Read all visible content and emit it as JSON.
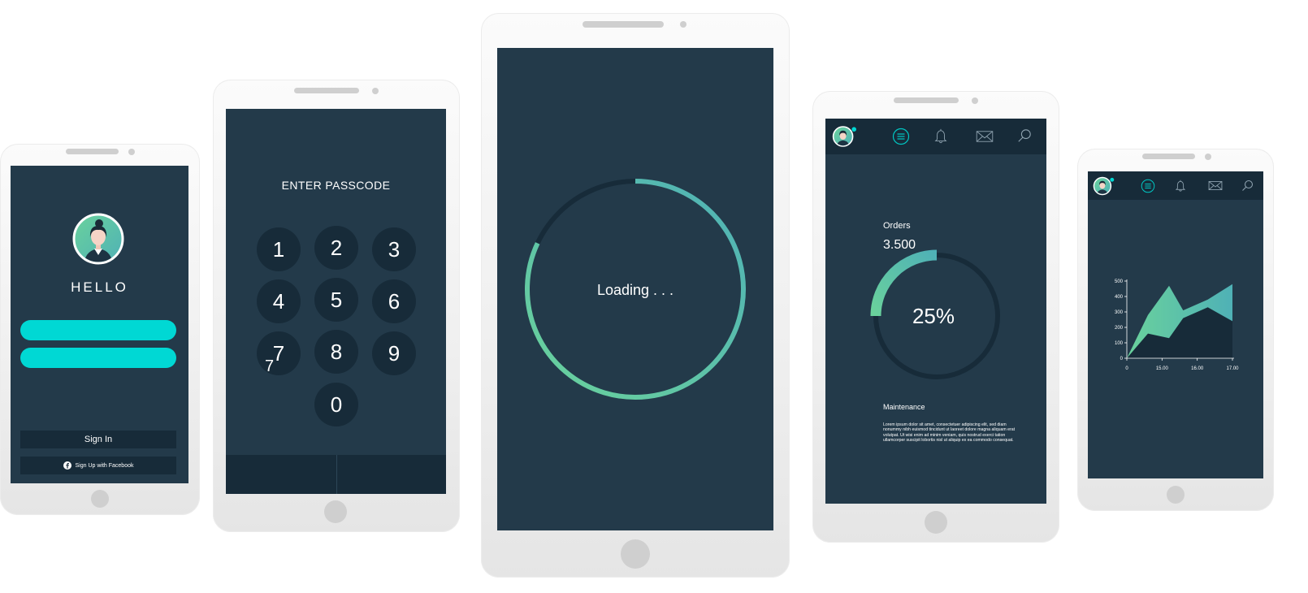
{
  "colors": {
    "screen": "#233a4a",
    "dark": "#172b39",
    "cyan": "#00d8d4",
    "green": "#6ad29c",
    "teal": "#4fb1b6",
    "device": "#f2f2f2"
  },
  "login": {
    "title": "HELLO",
    "username_value": "",
    "password_value": "",
    "sign_in_label": "Sign In",
    "facebook_label": "Sign Up with Facebook",
    "icons": [
      "avatar",
      "facebook-icon"
    ]
  },
  "passcode": {
    "title": "ENTER PASSCODE",
    "keys": [
      "1",
      "2",
      "3",
      "4",
      "5",
      "6",
      "7",
      "8",
      "9",
      "0"
    ],
    "stray_digit": "7"
  },
  "loading": {
    "label": "Loading . . .",
    "progress_fraction": 0.82
  },
  "dashboard": {
    "nav_icons": [
      "avatar",
      "menu-icon",
      "bell-icon",
      "mail-icon",
      "search-icon"
    ],
    "orders_label": "Orders",
    "orders_value": "3.500",
    "percent_label": "25%",
    "progress_fraction": 0.25,
    "maintenance_label": "Maintenance",
    "maintenance_text": "Lorem ipsum dolor sit amet, consectetuer adipiscing elit, sed diam nonummy nibh euismod tincidunt ut laoreet dolore magna aliquam erat volutpat. Ut wisi enim ad minim veniam, quis nostrud exerci tation ullamcorper suscipit lobortis nisl ut aliquip ex ea commodo consequat."
  },
  "chart_screen": {
    "nav_icons": [
      "avatar",
      "menu-icon",
      "bell-icon",
      "mail-icon",
      "search-icon"
    ]
  },
  "chart_data": {
    "type": "area",
    "title": "",
    "xlabel": "",
    "ylabel": "",
    "x_ticks": [
      "0",
      "15.00",
      "16.00",
      "17.00"
    ],
    "y_ticks": [
      "0",
      "100",
      "200",
      "300",
      "400",
      "500"
    ],
    "ylim": [
      0,
      500
    ],
    "series": [
      {
        "x": [
          0,
          0.6,
          1.2,
          1.6,
          2.3,
          3
        ],
        "values": [
          0,
          280,
          470,
          310,
          380,
          480
        ]
      },
      {
        "x": [
          0,
          0.6,
          1.2,
          1.6,
          2.3,
          3
        ],
        "values": [
          0,
          160,
          130,
          260,
          330,
          240
        ]
      }
    ],
    "x_tick_positions": [
      0,
      1,
      2,
      3
    ],
    "grid": false
  }
}
